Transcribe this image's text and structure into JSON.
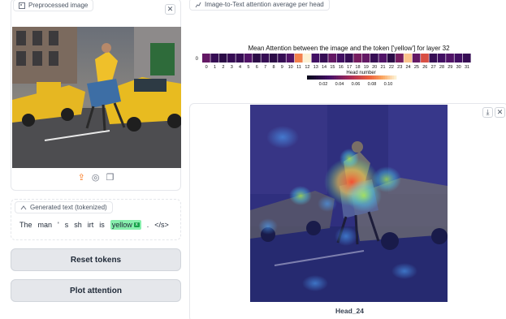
{
  "image_panel": {
    "label": "Preprocessed image",
    "close_icon": "close-icon",
    "tools": [
      "upload-icon",
      "camera-icon",
      "clipboard-icon"
    ]
  },
  "text_panel": {
    "label": "Generated text (tokenized)",
    "tokens": [
      "The",
      "man",
      "'",
      "s",
      "sh",
      "irt",
      "is",
      "yellow",
      ".",
      "</s>"
    ],
    "selected_token": "yellow",
    "selected_tag": "x"
  },
  "buttons": {
    "reset": "Reset tokens",
    "plot": "Plot attention"
  },
  "attention": {
    "label": "Image-to-Text attention average per head",
    "title": "Mean Attention between the image and the token ['yellow'] for layer 32",
    "y_tick": "0",
    "xlabel": "Head number",
    "colorbar_ticks": [
      "0.02",
      "0.04",
      "0.06",
      "0.08",
      "0.10"
    ]
  },
  "chart_data": {
    "type": "heatmap",
    "title": "Mean Attention between the image and the token ['yellow'] for layer 32",
    "xlabel": "Head number",
    "ylabel": "",
    "x": [
      0,
      1,
      2,
      3,
      4,
      5,
      6,
      7,
      8,
      9,
      10,
      11,
      12,
      13,
      14,
      15,
      16,
      17,
      18,
      19,
      20,
      21,
      22,
      23,
      24,
      25,
      26,
      27,
      28,
      29,
      30,
      31
    ],
    "y": [
      "0"
    ],
    "values": [
      [
        0.035,
        0.02,
        0.015,
        0.02,
        0.02,
        0.03,
        0.015,
        0.02,
        0.015,
        0.02,
        0.03,
        0.085,
        0.12,
        0.025,
        0.02,
        0.035,
        0.025,
        0.02,
        0.04,
        0.035,
        0.02,
        0.03,
        0.015,
        0.04,
        0.1,
        0.035,
        0.07,
        0.02,
        0.025,
        0.03,
        0.025,
        0.02
      ]
    ],
    "colorbar_range": [
      0.0,
      0.11
    ],
    "colorbar_ticks": [
      0.02,
      0.04,
      0.06,
      0.08,
      0.1
    ]
  },
  "heatmap_panel": {
    "caption": "Head_24",
    "download_icon": "download-icon",
    "close_icon": "close-icon"
  }
}
